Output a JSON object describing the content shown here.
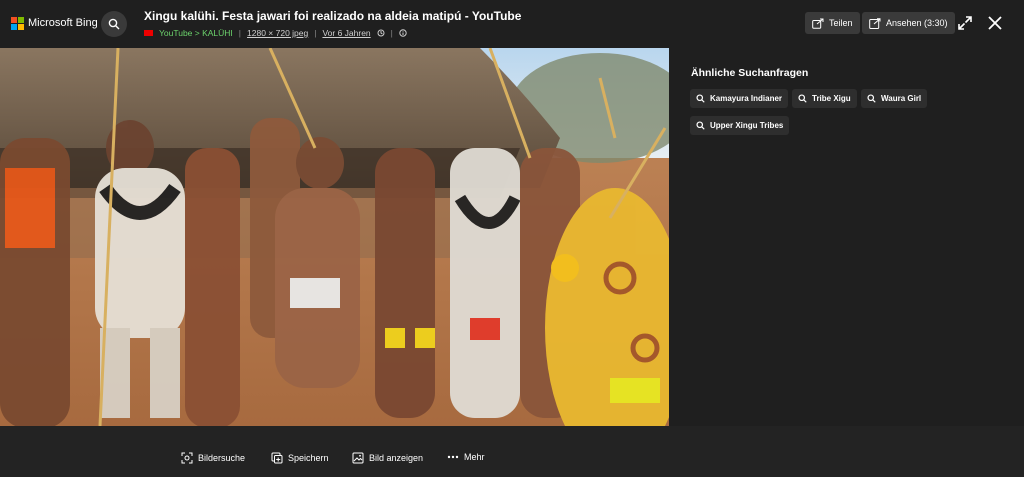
{
  "brand": {
    "name": "Microsoft Bing"
  },
  "header": {
    "title": "Xingu kalühi. Festa jawari foi realizado na aldeia matipú - YouTube",
    "source": "YouTube > KALÜHI",
    "dimensions": "1280 × 720 jpeg",
    "age": "Vor 6 Jahren",
    "share_label": "Teilen",
    "view_label": "Ansehen (3:30)"
  },
  "related": {
    "title": "Ähnliche Suchanfragen",
    "chips": [
      "Kamayura Indianer",
      "Tribe Xigu",
      "Waura Girl",
      "Upper Xingu Tribes"
    ]
  },
  "footer": {
    "visual_search": "Bildersuche",
    "save": "Speichern",
    "view_image": "Bild anzeigen",
    "more": "Mehr"
  },
  "colors": {
    "background": "#1f1f1f",
    "button": "#3a3a3a",
    "source_green": "#6cd36c"
  }
}
